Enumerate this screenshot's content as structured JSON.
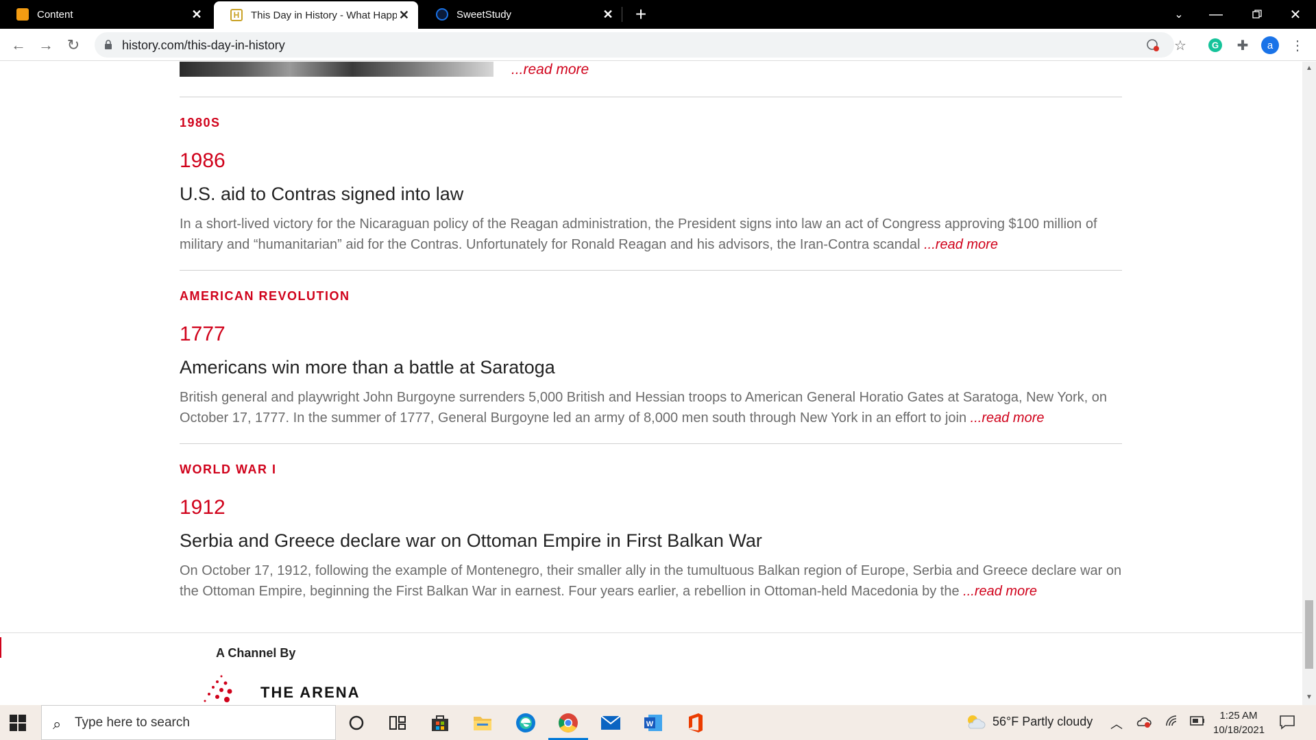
{
  "browser": {
    "tabs": [
      {
        "title": "Content",
        "active": false,
        "favicon_color": "#f39c12"
      },
      {
        "title": "This Day in History - What Happe",
        "active": true,
        "favicon_color": "#c9a227"
      },
      {
        "title": "SweetStudy",
        "active": false,
        "favicon_color": "#1a73e8"
      }
    ],
    "url": "history.com/this-day-in-history",
    "profile_initial": "a"
  },
  "page": {
    "top_read_more": "...read more",
    "entries": [
      {
        "category": "1980S",
        "year": "1986",
        "headline": "U.S. aid to Contras signed into law",
        "summary": "In a short-lived victory for the Nicaraguan policy of the Reagan administration, the President signs into law an act of Congress approving $100 million of military and “humanitarian” aid for the Contras. Unfortunately for Ronald Reagan and his advisors, the Iran-Contra scandal ",
        "read_more": "...read more"
      },
      {
        "category": "AMERICAN REVOLUTION",
        "year": "1777",
        "headline": "Americans win more than a battle at Saratoga",
        "summary": "British general and playwright John Burgoyne surrenders 5,000 British and Hessian troops to American General Horatio Gates at Saratoga, New York, on October 17, 1777. In the summer of 1777, General Burgoyne led an army of 8,000 men south through New York in an effort to join ",
        "read_more": "...read more"
      },
      {
        "category": "WORLD WAR I",
        "year": "1912",
        "headline": "Serbia and Greece declare war on Ottoman Empire in First Balkan War",
        "summary": "On October 17, 1912, following the example of Montenegro, their smaller ally in the tumultuous Balkan region of Europe, Serbia and Greece declare war on the Ottoman Empire, beginning the First Balkan War in earnest. Four years earlier, a rebellion in Ottoman-held Macedonia by the ",
        "read_more": "...read more"
      }
    ],
    "footer": {
      "channel_by": "A Channel By",
      "brand": "THE ARENA"
    },
    "accent_color": "#d0021b"
  },
  "taskbar": {
    "search_placeholder": "Type here to search",
    "weather": "56°F  Partly cloudy",
    "time": "1:25 AM",
    "date": "10/18/2021"
  }
}
